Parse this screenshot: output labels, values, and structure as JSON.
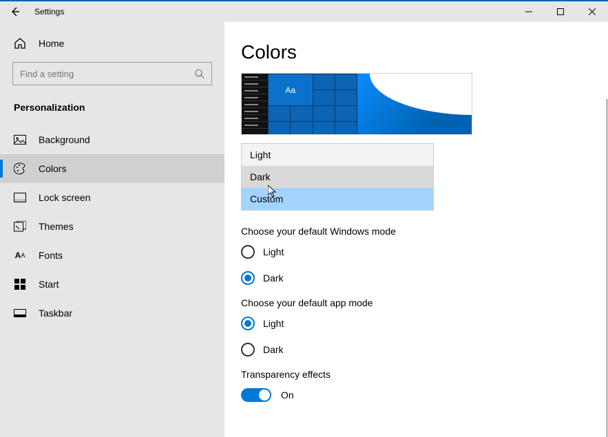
{
  "titlebar": {
    "title": "Settings"
  },
  "sidebar": {
    "home": "Home",
    "search_placeholder": "Find a setting",
    "section": "Personalization",
    "items": [
      {
        "label": "Background"
      },
      {
        "label": "Colors"
      },
      {
        "label": "Lock screen"
      },
      {
        "label": "Themes"
      },
      {
        "label": "Fonts"
      },
      {
        "label": "Start"
      },
      {
        "label": "Taskbar"
      }
    ]
  },
  "content": {
    "title": "Colors",
    "preview_tile_text": "Aa",
    "color_mode_options": [
      "Light",
      "Dark",
      "Custom"
    ],
    "windows_mode": {
      "label": "Choose your default Windows mode",
      "options": [
        "Light",
        "Dark"
      ],
      "selected": "Dark"
    },
    "app_mode": {
      "label": "Choose your default app mode",
      "options": [
        "Light",
        "Dark"
      ],
      "selected": "Light"
    },
    "transparency": {
      "label": "Transparency effects",
      "state": "On"
    }
  }
}
